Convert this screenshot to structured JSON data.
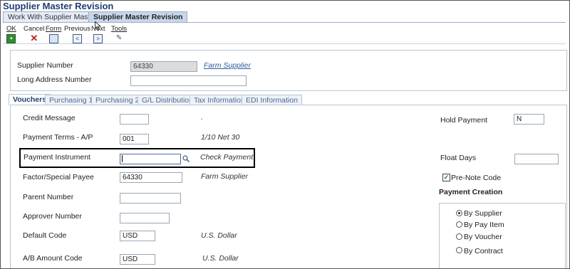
{
  "app": {
    "title": "Supplier Master Revision"
  },
  "app_tabs": [
    {
      "label": "Work With Supplier Master",
      "active": false
    },
    {
      "label": "Supplier Master Revision",
      "active": true
    }
  ],
  "toolbar": {
    "ok": {
      "label": "OK",
      "icon": "save-icon"
    },
    "cancel": {
      "label": "Cancel",
      "icon": "close-icon"
    },
    "form": {
      "label": "Form",
      "icon": "form-icon"
    },
    "previous": {
      "label": "Previous",
      "icon": "chevron-left-icon"
    },
    "next": {
      "label": "Next",
      "icon": "chevron-right-icon"
    },
    "tools": {
      "label": "Tools",
      "icon": "tools-icon"
    }
  },
  "header": {
    "supplier_number": {
      "label": "Supplier Number",
      "value": "64330",
      "link": "Farm Supplier"
    },
    "long_address_number": {
      "label": "Long Address Number",
      "value": ""
    }
  },
  "form_tabs": [
    {
      "label": "Vouchers",
      "active": true
    },
    {
      "label": "Purchasing 1",
      "active": false
    },
    {
      "label": "Purchasing 2",
      "active": false
    },
    {
      "label": "G/L Distribution",
      "active": false
    },
    {
      "label": "Tax Information",
      "active": false
    },
    {
      "label": "EDI Information",
      "active": false
    }
  ],
  "vouchers": {
    "credit_message": {
      "label": "Credit Message",
      "value": "",
      "desc": "."
    },
    "payment_terms": {
      "label": "Payment Terms - A/P",
      "value": "001",
      "desc": "1/10 Net 30"
    },
    "payment_instrument": {
      "label": "Payment Instrument",
      "value": "",
      "desc": "Check Payment"
    },
    "factor_special_payee": {
      "label": "Factor/Special Payee",
      "value": "64330",
      "desc": "Farm Supplier"
    },
    "parent_number": {
      "label": "Parent Number",
      "value": ""
    },
    "approver_number": {
      "label": "Approver Number",
      "value": ""
    },
    "default_code": {
      "label": "Default Code",
      "value": "USD",
      "desc": "U.S. Dollar"
    },
    "ab_amount_code": {
      "label": "A/B Amount Code",
      "value": "USD",
      "desc": "U.S. Dollar"
    },
    "hold_payment": {
      "label": "Hold Payment",
      "value": "N"
    },
    "float_days": {
      "label": "Float Days",
      "value": ""
    },
    "pre_note_code": {
      "label": "Pre-Note Code",
      "checked": true
    }
  },
  "payment_creation": {
    "title": "Payment Creation",
    "options": [
      {
        "label": "By Supplier",
        "selected": true
      },
      {
        "label": "By Pay Item",
        "selected": false
      },
      {
        "label": "By Voucher",
        "selected": false
      },
      {
        "label": "By Contract",
        "selected": false
      }
    ]
  },
  "colors": {
    "title": "#1f3d7a",
    "tab_active": "#c8d8ea",
    "link": "#2a5fa8",
    "border": "#b9c6d6"
  }
}
